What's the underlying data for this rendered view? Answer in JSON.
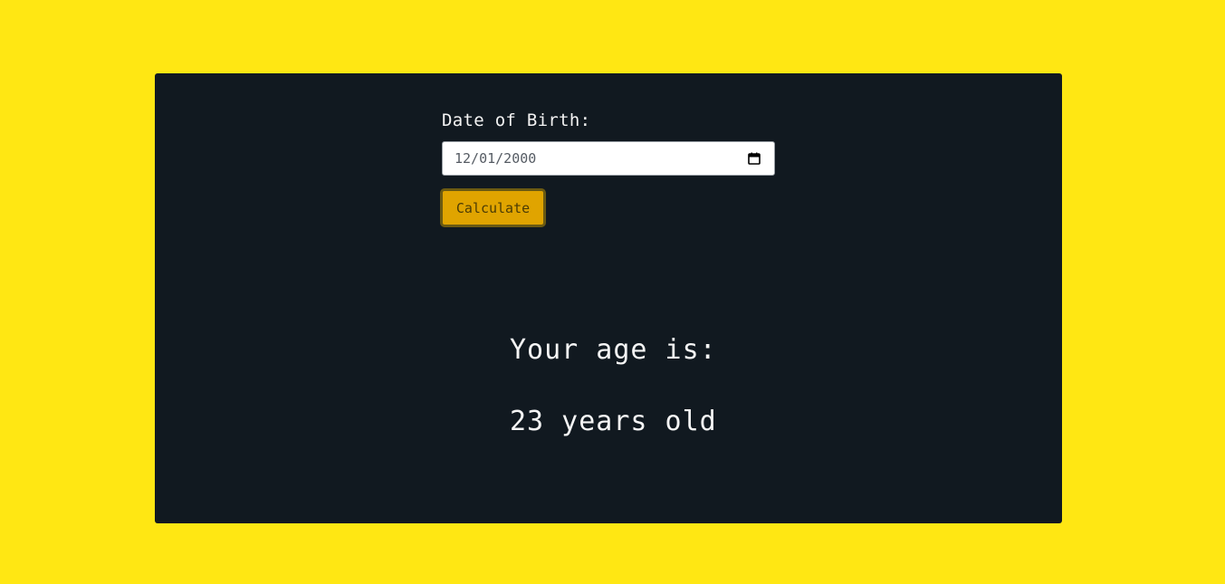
{
  "form": {
    "label": "Date of Birth:",
    "date_value": "12/01/2000",
    "calendar_icon": "calendar-icon",
    "button_label": "Calculate"
  },
  "result": {
    "heading": "Your age is:",
    "value": "23 years old"
  },
  "colors": {
    "page_background": "#ffe713",
    "card_background": "#111920",
    "button_background": "#e0a400",
    "text": "#f5f5f5"
  }
}
